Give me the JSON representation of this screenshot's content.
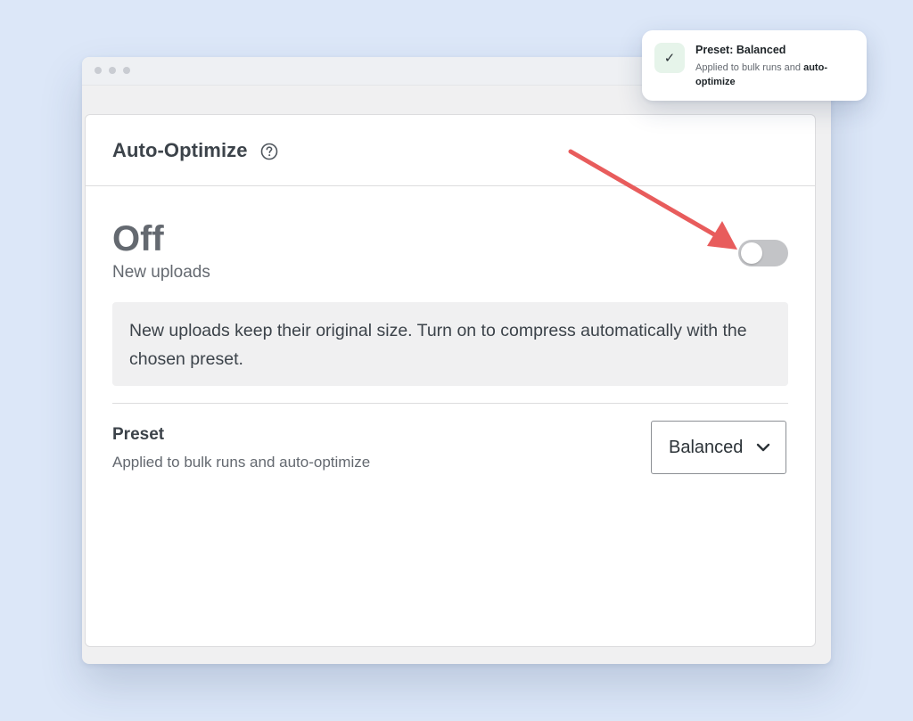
{
  "card": {
    "title": "Auto-Optimize",
    "help_icon": "question-circle-icon"
  },
  "status": {
    "value": "Off",
    "label": "New uploads",
    "toggle_on": false
  },
  "notice": {
    "text": "New uploads keep their original size. Turn on to compress automatically with the chosen preset."
  },
  "preset": {
    "label": "Preset",
    "description": "Applied to bulk runs and auto-optimize",
    "selected": "Balanced"
  },
  "toast": {
    "icon": "check-icon",
    "title": "Preset: Balanced",
    "desc_prefix": "Applied to bulk runs and ",
    "desc_bold": "auto-optimize"
  },
  "colors": {
    "background": "#dce7f8",
    "arrow": "#e85c5c",
    "toggle_off": "#c3c4c7",
    "toast_icon_bg": "#e6f4ea"
  }
}
